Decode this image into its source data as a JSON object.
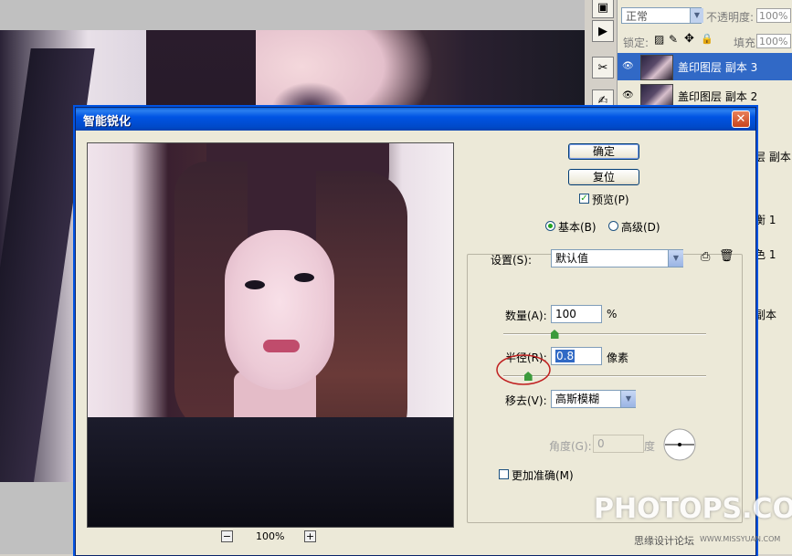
{
  "layers_panel": {
    "blend_mode": "正常",
    "opacity_label": "不透明度:",
    "opacity_value": "100%",
    "lock_label": "锁定:",
    "fill_label": "填充:",
    "fill_value": "100%",
    "layers": [
      {
        "name": "盖印图层 副本 3",
        "selected": true
      },
      {
        "name": "盖印图层 副本 2",
        "selected": false
      }
    ],
    "fragments": [
      "层 副本",
      "衡 1",
      "色 1",
      "副本"
    ]
  },
  "dialog": {
    "title": "智能锐化",
    "close_glyph": "✕",
    "ok_label": "确定",
    "reset_label": "复位",
    "preview_label": "预览(P)",
    "preview_checked": true,
    "mode_basic": "基本(B)",
    "mode_advanced": "高级(D)",
    "selected_mode": "basic",
    "settings_label": "设置(S):",
    "settings_value": "默认值",
    "amount_label": "数量(A):",
    "amount_value": "100",
    "amount_unit": "%",
    "amount_fraction": 0.25,
    "radius_label": "半径(R):",
    "radius_value": "0.8",
    "radius_unit": "像素",
    "radius_fraction": 0.12,
    "remove_label": "移去(V):",
    "remove_value": "高斯模糊",
    "angle_label": "角度(G):",
    "angle_value": "0",
    "angle_unit": "度",
    "more_accurate_label": "更加准确(M)",
    "more_accurate_checked": false,
    "zoom_minus": "−",
    "zoom_level": "100%",
    "zoom_plus": "+"
  },
  "watermark": {
    "main": "PHOTOPS.COM",
    "sub": "思缘设计论坛",
    "sub2": "WWW.MISSYUAN.COM"
  },
  "icons": [
    "eye-icon",
    "trash-icon",
    "save-settings-icon",
    "lock-icon",
    "brush-icon",
    "move-icon"
  ]
}
